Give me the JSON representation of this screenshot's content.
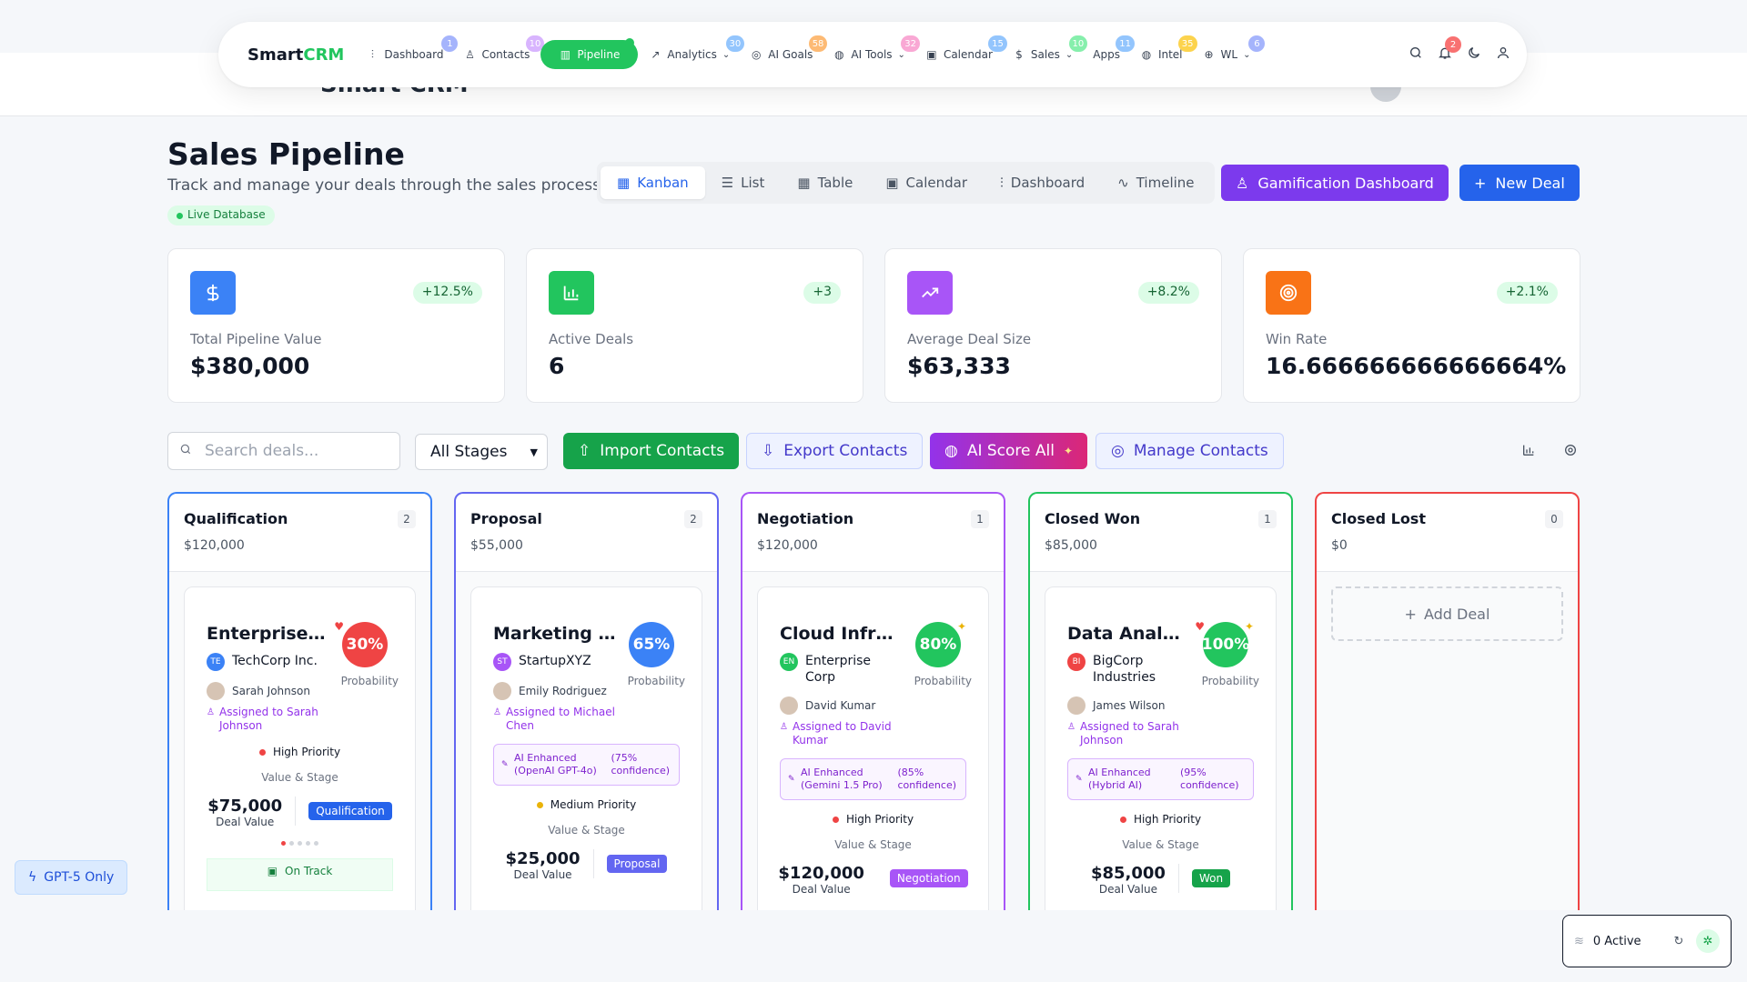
{
  "ghost_header": {
    "title": "Smart CRM"
  },
  "nav": {
    "brand_a": "Smart",
    "brand_b": "CRM",
    "items": [
      {
        "label": "Dashboard",
        "badge": "1",
        "badge_color": "#a5b4fc",
        "icon": "bar-chart-icon"
      },
      {
        "label": "Contacts",
        "badge": "10",
        "badge_color": "#d8b4fe",
        "icon": "users-icon"
      },
      {
        "label": "Pipeline",
        "badge": "",
        "badge_color": "#22c55e",
        "icon": "pipeline-icon"
      },
      {
        "label": "Analytics",
        "badge": "30",
        "badge_color": "#93c5fd",
        "icon": "trend-icon"
      },
      {
        "label": "AI Goals",
        "badge": "58",
        "badge_color": "#fdba74",
        "icon": "target-icon"
      },
      {
        "label": "AI Tools",
        "badge": "32",
        "badge_color": "#f9a8d4",
        "icon": "brain-icon"
      },
      {
        "label": "Calendar",
        "badge": "15",
        "badge_color": "#93c5fd",
        "icon": "calendar-icon"
      },
      {
        "label": "Sales",
        "badge": "10",
        "badge_color": "#86efac",
        "icon": "dollar-icon"
      },
      {
        "label": "Apps",
        "badge": "11",
        "badge_color": "#93c5fd",
        "icon": "apps-icon"
      },
      {
        "label": "Intel",
        "badge": "35",
        "badge_color": "#fcd34d",
        "icon": "intel-icon"
      },
      {
        "label": "WL",
        "badge": "6",
        "badge_color": "#a5b4fc",
        "icon": "globe-icon"
      }
    ],
    "notif_count": "2"
  },
  "header": {
    "title": "Sales Pipeline",
    "subtitle": "Track and manage your deals through the sales process",
    "live": "Live Database",
    "tabs": [
      "Kanban",
      "List",
      "Table",
      "Calendar",
      "Dashboard",
      "Timeline"
    ],
    "gamification": "Gamification Dashboard",
    "new_deal": "New Deal"
  },
  "stats": [
    {
      "label": "Total Pipeline Value",
      "value": "$380,000",
      "change": "+12.5%",
      "color": "#3b82f6",
      "icon": "dollar-icon"
    },
    {
      "label": "Active Deals",
      "value": "6",
      "change": "+3",
      "color": "#22c55e",
      "icon": "bar-chart-icon"
    },
    {
      "label": "Average Deal Size",
      "value": "$63,333",
      "change": "+8.2%",
      "color": "#a855f7",
      "icon": "trend-icon"
    },
    {
      "label": "Win Rate",
      "value": "16.666666666666664%",
      "change": "+2.1%",
      "color": "#f97316",
      "icon": "target-icon"
    }
  ],
  "toolbar": {
    "search_placeholder": "Search deals...",
    "stage_select": "All Stages",
    "import": "Import Contacts",
    "export": "Export Contacts",
    "ai_score": "AI Score All",
    "manage": "Manage Contacts"
  },
  "columns": [
    {
      "title": "Qualification",
      "amount": "$120,000",
      "count": "2",
      "color": "#3b82f6"
    },
    {
      "title": "Proposal",
      "amount": "$55,000",
      "count": "2",
      "color": "#6366f1"
    },
    {
      "title": "Negotiation",
      "amount": "$120,000",
      "count": "1",
      "color": "#a855f7"
    },
    {
      "title": "Closed Won",
      "amount": "$85,000",
      "count": "1",
      "color": "#22c55e"
    },
    {
      "title": "Closed Lost",
      "amount": "$0",
      "count": "0",
      "color": "#ef4444"
    }
  ],
  "cards": [
    {
      "title": "Enterprise ...",
      "prob": "30%",
      "prob_color": "#ef4444",
      "prob_label": "Probability",
      "company": "TechCorp Inc.",
      "company_initials": "TE",
      "company_color": "#3b82f6",
      "person": "Sarah Johnson",
      "assigned": "Assigned to Sarah Johnson",
      "ai_left": "",
      "ai_right": "",
      "priority": "High Priority",
      "priority_color": "#ef4444",
      "vs": "Value & Stage",
      "amount": "$75,000",
      "deal_value": "Deal Value",
      "stage": "Qualification",
      "stage_color": "#2563eb",
      "ontrack": "On Track"
    },
    {
      "title": "Marketing A...",
      "prob": "65%",
      "prob_color": "#3b82f6",
      "prob_label": "Probability",
      "company": "StartupXYZ",
      "company_initials": "ST",
      "company_color": "#a855f7",
      "person": "Emily Rodriguez",
      "assigned": "Assigned to Michael Chen",
      "ai_left": "AI Enhanced (OpenAI GPT-4o)",
      "ai_right": "(75% confidence)",
      "priority": "Medium Priority",
      "priority_color": "#eab308",
      "vs": "Value & Stage",
      "amount": "$25,000",
      "deal_value": "Deal Value",
      "stage": "Proposal",
      "stage_color": "#6366f1"
    },
    {
      "title": "Cloud Infras...",
      "prob": "80%",
      "prob_color": "#22c55e",
      "prob_label": "Probability",
      "company": "Enterprise Corp",
      "company_initials": "EN",
      "company_color": "#22c55e",
      "person": "David Kumar",
      "assigned": "Assigned to David Kumar",
      "ai_left": "AI Enhanced (Gemini 1.5 Pro)",
      "ai_right": "(85% confidence)",
      "priority": "High Priority",
      "priority_color": "#ef4444",
      "vs": "Value & Stage",
      "amount": "$120,000",
      "deal_value": "Deal Value",
      "stage": "Negotiation",
      "stage_color": "#a855f7"
    },
    {
      "title": "Data Analyt...",
      "prob": "100%",
      "prob_color": "#22c55e",
      "prob_label": "Probability",
      "company": "BigCorp Industries",
      "company_initials": "BI",
      "company_color": "#ef4444",
      "person": "James Wilson",
      "assigned": "Assigned to Sarah Johnson",
      "ai_left": "AI Enhanced (Hybrid AI)",
      "ai_right": "(95% confidence)",
      "priority": "High Priority",
      "priority_color": "#ef4444",
      "vs": "Value & Stage",
      "amount": "$85,000",
      "deal_value": "Deal Value",
      "stage": "Won",
      "stage_color": "#16a34a"
    }
  ],
  "add_deal": "Add Deal",
  "gpt5": "GPT-5 Only",
  "active": "0 Active"
}
